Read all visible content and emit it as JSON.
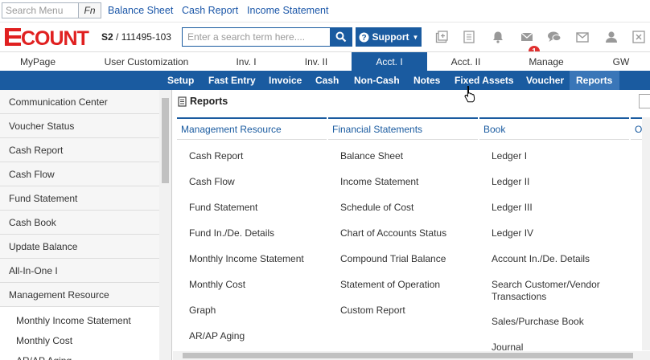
{
  "quickbar": {
    "search_placeholder": "Search Menu",
    "fn_label": "Fn",
    "links": [
      "Balance Sheet",
      "Cash Report",
      "Income Statement"
    ]
  },
  "header": {
    "logo_text": "ECOUNT",
    "company_prefix": "S2",
    "company_code": "/ 111495-103",
    "search_placeholder": "Enter a search term here....",
    "support_label": "Support",
    "notification_count": "1",
    "icons": [
      "add-window-icon",
      "document-icon",
      "bell-icon",
      "message-icon",
      "chat-icon",
      "mail-icon",
      "user-icon",
      "close-icon"
    ]
  },
  "top_tabs": [
    "MyPage",
    "User Customization",
    "Inv. I",
    "Inv. II",
    "Acct. I",
    "Acct. II",
    "Manage",
    "GW"
  ],
  "active_top_tab": "Acct. I",
  "sub_tabs": [
    "Setup",
    "Fast Entry",
    "Invoice",
    "Cash",
    "Non-Cash",
    "Notes",
    "Fixed Assets",
    "Voucher",
    "Reports"
  ],
  "active_sub_tab": "Reports",
  "sidebar": {
    "items": [
      "Communication Center",
      "Voucher Status",
      "Cash Report",
      "Cash Flow",
      "Fund Statement",
      "Cash Book",
      "Update Balance",
      "All-In-One I",
      "Management Resource"
    ],
    "sub_items": [
      "Monthly Income Statement",
      "Monthly Cost",
      "AR/AP Aging"
    ]
  },
  "content": {
    "title": "Reports",
    "columns": [
      {
        "header": "Management Resource",
        "items": [
          "Cash Report",
          "Cash Flow",
          "Fund Statement",
          "Fund In./De. Details",
          "Monthly Income Statement",
          "Monthly Cost",
          "Graph",
          "AR/AP Aging"
        ]
      },
      {
        "header": "Financial Statements",
        "items": [
          "Balance Sheet",
          "Income Statement",
          "Schedule of Cost",
          "Chart of Accounts Status",
          "Compound Trial Balance",
          "Statement of Operation",
          "Custom Report"
        ]
      },
      {
        "header": "Book",
        "items": [
          "Ledger I",
          "Ledger II",
          "Ledger III",
          "Ledger IV",
          "Account In./De. Details",
          "Search Customer/Vendor Transactions",
          "Sales/Purchase Book",
          "Journal"
        ]
      },
      {
        "header": "O"
      }
    ]
  },
  "colors": {
    "brand_blue": "#1a5ba0",
    "logo_red": "#e02020",
    "badge_red": "#e03030"
  }
}
